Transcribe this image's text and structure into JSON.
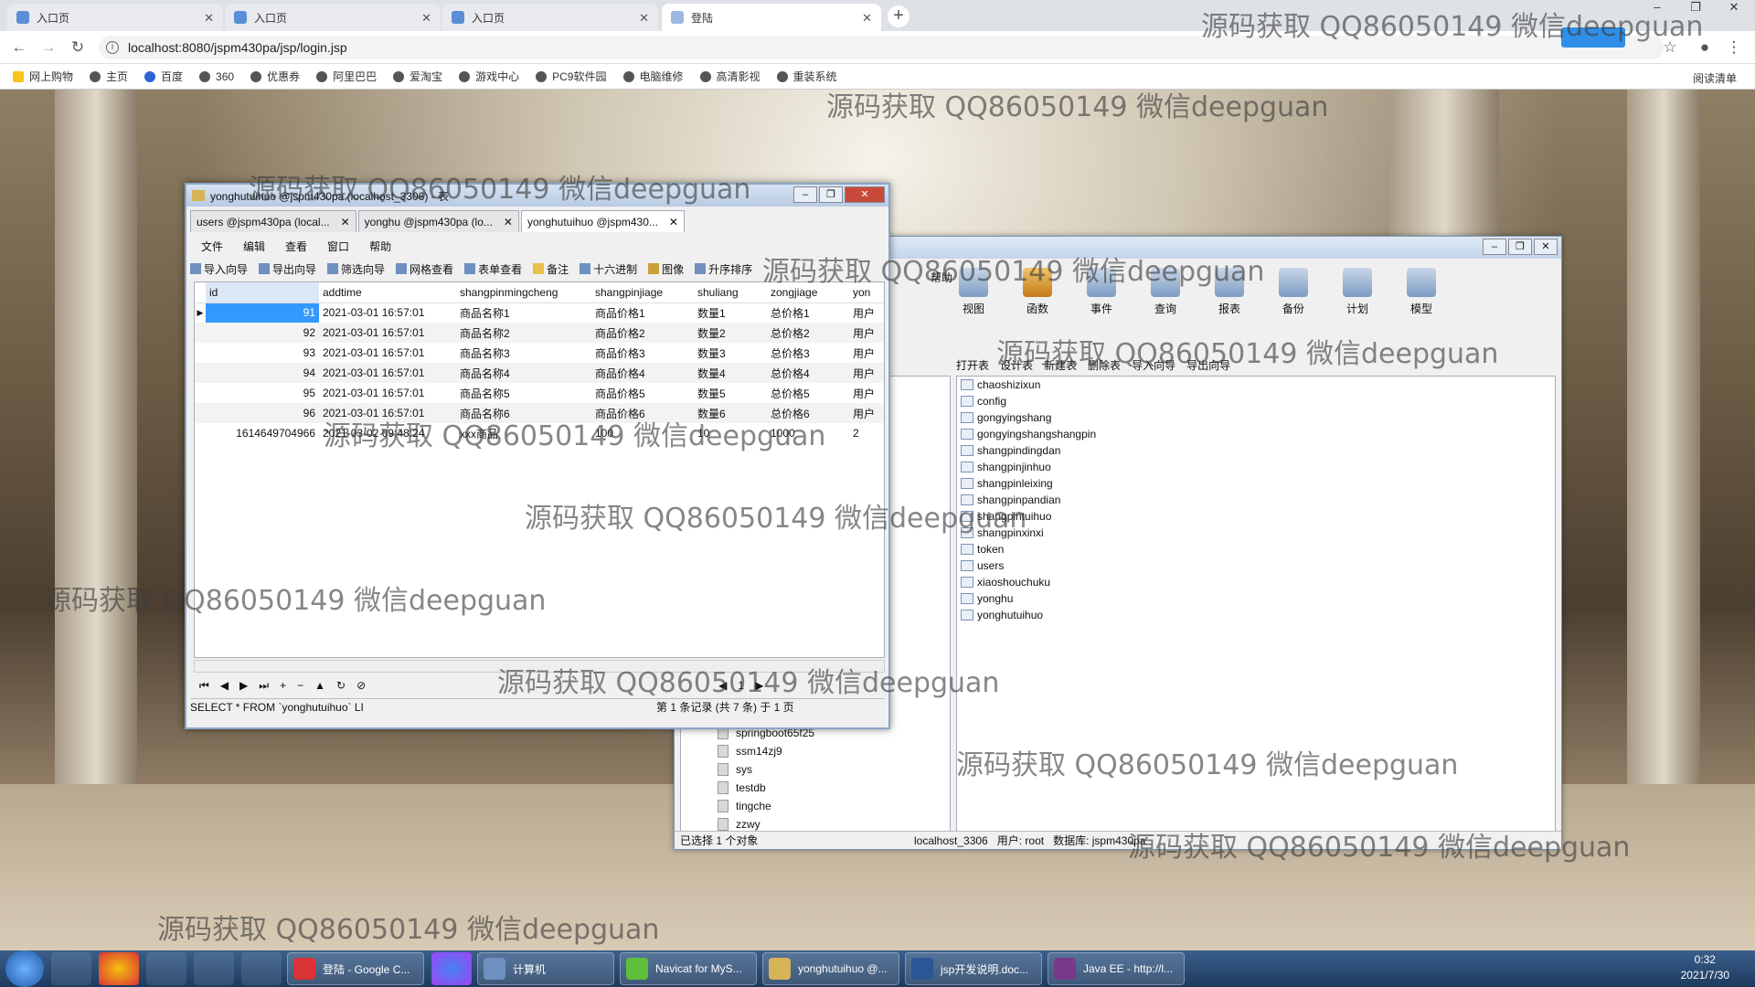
{
  "browser": {
    "tabs": [
      "入口页",
      "入口页",
      "入口页",
      "登陆"
    ],
    "url": "localhost:8080/jspm430pa/jsp/login.jsp",
    "bookmarks": [
      "网上购物",
      "主页",
      "百度",
      "360",
      "优惠券",
      "阿里巴巴",
      "爱淘宝",
      "游戏中心",
      "PC9软件园",
      "电脑维修",
      "高清影视",
      "重装系统"
    ],
    "reading_list": "阅读清单"
  },
  "watermark": "源码获取 QQ86050149 微信deepguan",
  "navicat": {
    "menu_help": "帮助",
    "ribbon": [
      "视图",
      "函数",
      "事件",
      "查询",
      "报表",
      "备份",
      "计划",
      "模型"
    ],
    "object_toolbar": [
      "打开表",
      "设计表",
      "新建表",
      "删除表",
      "导入向导",
      "导出向导"
    ],
    "tables": [
      "chaoshizixun",
      "config",
      "gongyingshang",
      "gongyingshangshangpin",
      "shangpindingdan",
      "shangpinjinhuo",
      "shangpinleixing",
      "shangpinpandian",
      "shangpintuihuo",
      "shangpinxinxi",
      "token",
      "users",
      "xiaoshouchuku",
      "yonghu",
      "yonghutuihuo"
    ],
    "databases": [
      "springboot65f25",
      "ssm14zj9",
      "sys",
      "testdb",
      "tingche",
      "zzwy"
    ],
    "status": {
      "selected": "已选择 1 个对象",
      "connection": "localhost_3306",
      "user": "用户: root",
      "database": "数据库: jspm430pa"
    }
  },
  "table_window": {
    "title": "yonghutuihuo @jspm430pa (localhost_3306) - 表",
    "tabs": [
      "users @jspm430pa (local...",
      "yonghu @jspm430pa (lo...",
      "yonghutuihuo @jspm430..."
    ],
    "menu": [
      "文件",
      "编辑",
      "查看",
      "窗口",
      "帮助"
    ],
    "toolbar": [
      "导入向导",
      "导出向导",
      "筛选向导",
      "网格查看",
      "表单查看",
      "备注",
      "十六进制",
      "图像",
      "升序排序"
    ],
    "columns": [
      "id",
      "addtime",
      "shangpinmingcheng",
      "shangpinjiage",
      "shuliang",
      "zongjiage",
      "yon"
    ],
    "rows": [
      [
        "91",
        "2021-03-01 16:57:01",
        "商品名称1",
        "商品价格1",
        "数量1",
        "总价格1",
        "用户"
      ],
      [
        "92",
        "2021-03-01 16:57:01",
        "商品名称2",
        "商品价格2",
        "数量2",
        "总价格2",
        "用户"
      ],
      [
        "93",
        "2021-03-01 16:57:01",
        "商品名称3",
        "商品价格3",
        "数量3",
        "总价格3",
        "用户"
      ],
      [
        "94",
        "2021-03-01 16:57:01",
        "商品名称4",
        "商品价格4",
        "数量4",
        "总价格4",
        "用户"
      ],
      [
        "95",
        "2021-03-01 16:57:01",
        "商品名称5",
        "商品价格5",
        "数量5",
        "总价格5",
        "用户"
      ],
      [
        "96",
        "2021-03-01 16:57:01",
        "商品名称6",
        "商品价格6",
        "数量6",
        "总价格6",
        "用户"
      ],
      [
        "1614649704966",
        "2021-03-02 09:48:24",
        "xxx商品",
        "100",
        "10",
        "1000",
        "2"
      ]
    ],
    "sql": "SELECT * FROM `yonghutuihuo` LI",
    "record_info": "第 1 条记录 (共 7 条) 于 1 页",
    "page": "1"
  },
  "taskbar": {
    "items": [
      "登陆 - Google C...",
      "计算机",
      "Navicat for MyS...",
      "yonghutuihuo @...",
      "jsp开发说明.doc...",
      "Java EE - http://l..."
    ],
    "time": "0:32",
    "date": "2021/7/30"
  }
}
